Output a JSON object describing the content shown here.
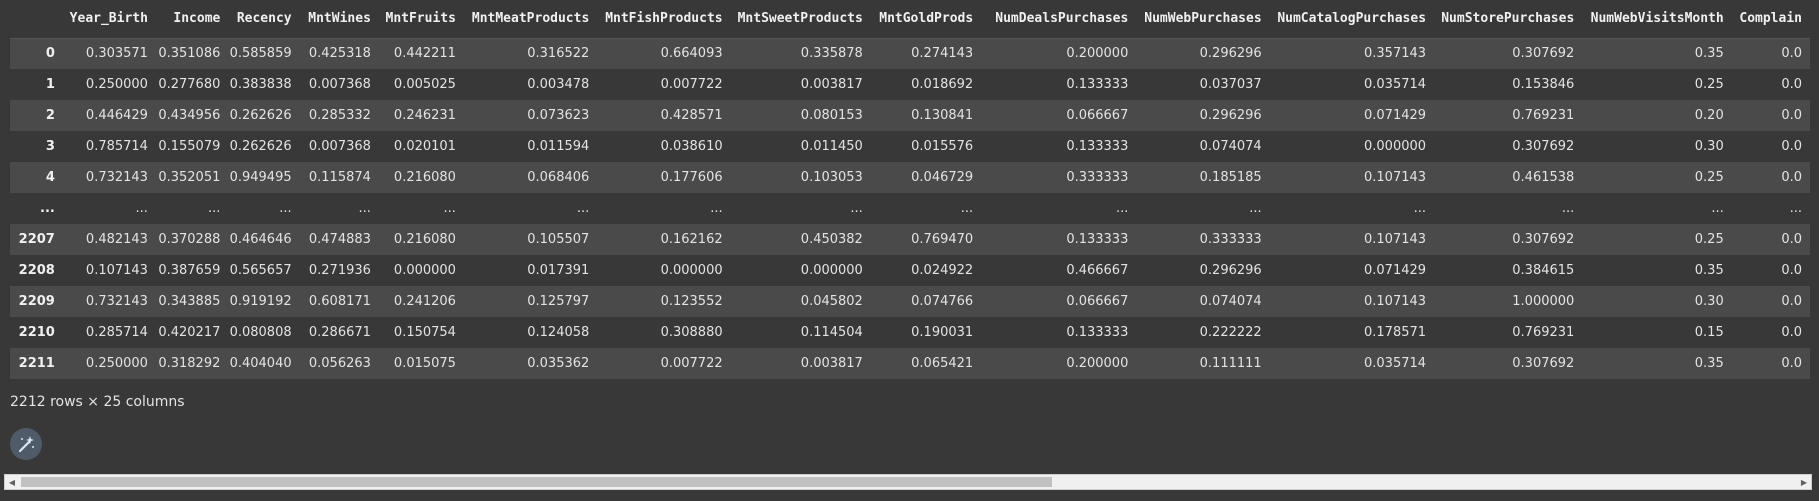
{
  "columns": [
    "",
    "Year_Birth",
    "Income",
    "Recency",
    "MntWines",
    "MntFruits",
    "MntMeatProducts",
    "MntFishProducts",
    "MntSweetProducts",
    "MntGoldProds",
    "NumDealsPurchases",
    "NumWebPurchases",
    "NumCatalogPurchases",
    "NumStorePurchases",
    "NumWebVisitsMonth",
    "Complain"
  ],
  "rows": [
    {
      "index": "0",
      "cells": [
        "0.303571",
        "0.351086",
        "0.585859",
        "0.425318",
        "0.442211",
        "0.316522",
        "0.664093",
        "0.335878",
        "0.274143",
        "0.200000",
        "0.296296",
        "0.357143",
        "0.307692",
        "0.35",
        "0.0"
      ]
    },
    {
      "index": "1",
      "cells": [
        "0.250000",
        "0.277680",
        "0.383838",
        "0.007368",
        "0.005025",
        "0.003478",
        "0.007722",
        "0.003817",
        "0.018692",
        "0.133333",
        "0.037037",
        "0.035714",
        "0.153846",
        "0.25",
        "0.0"
      ]
    },
    {
      "index": "2",
      "cells": [
        "0.446429",
        "0.434956",
        "0.262626",
        "0.285332",
        "0.246231",
        "0.073623",
        "0.428571",
        "0.080153",
        "0.130841",
        "0.066667",
        "0.296296",
        "0.071429",
        "0.769231",
        "0.20",
        "0.0"
      ]
    },
    {
      "index": "3",
      "cells": [
        "0.785714",
        "0.155079",
        "0.262626",
        "0.007368",
        "0.020101",
        "0.011594",
        "0.038610",
        "0.011450",
        "0.015576",
        "0.133333",
        "0.074074",
        "0.000000",
        "0.307692",
        "0.30",
        "0.0"
      ]
    },
    {
      "index": "4",
      "cells": [
        "0.732143",
        "0.352051",
        "0.949495",
        "0.115874",
        "0.216080",
        "0.068406",
        "0.177606",
        "0.103053",
        "0.046729",
        "0.333333",
        "0.185185",
        "0.107143",
        "0.461538",
        "0.25",
        "0.0"
      ]
    },
    {
      "index": "...",
      "cells": [
        "...",
        "...",
        "...",
        "...",
        "...",
        "...",
        "...",
        "...",
        "...",
        "...",
        "...",
        "...",
        "...",
        "...",
        "..."
      ]
    },
    {
      "index": "2207",
      "cells": [
        "0.482143",
        "0.370288",
        "0.464646",
        "0.474883",
        "0.216080",
        "0.105507",
        "0.162162",
        "0.450382",
        "0.769470",
        "0.133333",
        "0.333333",
        "0.107143",
        "0.307692",
        "0.25",
        "0.0"
      ]
    },
    {
      "index": "2208",
      "cells": [
        "0.107143",
        "0.387659",
        "0.565657",
        "0.271936",
        "0.000000",
        "0.017391",
        "0.000000",
        "0.000000",
        "0.024922",
        "0.466667",
        "0.296296",
        "0.071429",
        "0.384615",
        "0.35",
        "0.0"
      ]
    },
    {
      "index": "2209",
      "cells": [
        "0.732143",
        "0.343885",
        "0.919192",
        "0.608171",
        "0.241206",
        "0.125797",
        "0.123552",
        "0.045802",
        "0.074766",
        "0.066667",
        "0.074074",
        "0.107143",
        "1.000000",
        "0.30",
        "0.0"
      ]
    },
    {
      "index": "2210",
      "cells": [
        "0.285714",
        "0.420217",
        "0.080808",
        "0.286671",
        "0.150754",
        "0.124058",
        "0.308880",
        "0.114504",
        "0.190031",
        "0.133333",
        "0.222222",
        "0.178571",
        "0.769231",
        "0.15",
        "0.0"
      ]
    },
    {
      "index": "2211",
      "cells": [
        "0.250000",
        "0.318292",
        "0.404040",
        "0.056263",
        "0.015075",
        "0.035362",
        "0.007722",
        "0.003817",
        "0.065421",
        "0.200000",
        "0.111111",
        "0.035714",
        "0.307692",
        "0.35",
        "0.0"
      ]
    }
  ],
  "footer": {
    "shape_text": "2212 rows × 25 columns"
  },
  "icons": {
    "magic": "magic-wand-icon",
    "scroll_left": "scroll-left-arrow-icon",
    "scroll_right": "scroll-right-arrow-icon"
  },
  "colors": {
    "background": "#383838",
    "row_alt": "#4a4a4a",
    "magic_button": "#4f5b68"
  }
}
